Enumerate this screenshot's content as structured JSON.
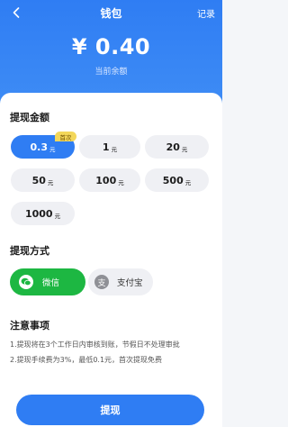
{
  "nav": {
    "back_icon": "chevron-left-icon",
    "title": "钱包",
    "right_label": "记录"
  },
  "balance": {
    "amount": "¥ 0.40",
    "label": "当前余额"
  },
  "withdraw_amount": {
    "title": "提现金额",
    "first_badge": "首次",
    "unit": "元",
    "options": [
      {
        "value": "0.3",
        "selected": true
      },
      {
        "value": "1",
        "selected": false
      },
      {
        "value": "20",
        "selected": false
      },
      {
        "value": "50",
        "selected": false
      },
      {
        "value": "100",
        "selected": false
      },
      {
        "value": "500",
        "selected": false
      },
      {
        "value": "1000",
        "selected": false
      }
    ]
  },
  "withdraw_method": {
    "title": "提现方式",
    "options": [
      {
        "label": "微信",
        "icon": "wechat-icon",
        "selected": true,
        "color": "#1db742"
      },
      {
        "label": "支付宝",
        "icon": "alipay-icon",
        "selected": false
      }
    ]
  },
  "notes": {
    "title": "注意事项",
    "items": [
      "1.提现将在3个工作日内审核到账，节假日不处理审批",
      "2.提现手续费为3%，最低0.1元，首次提现免费"
    ]
  },
  "submit_label": "提现",
  "colors": {
    "primary": "#2f7df3",
    "wechat": "#1db742",
    "badge": "#f3d75a"
  }
}
